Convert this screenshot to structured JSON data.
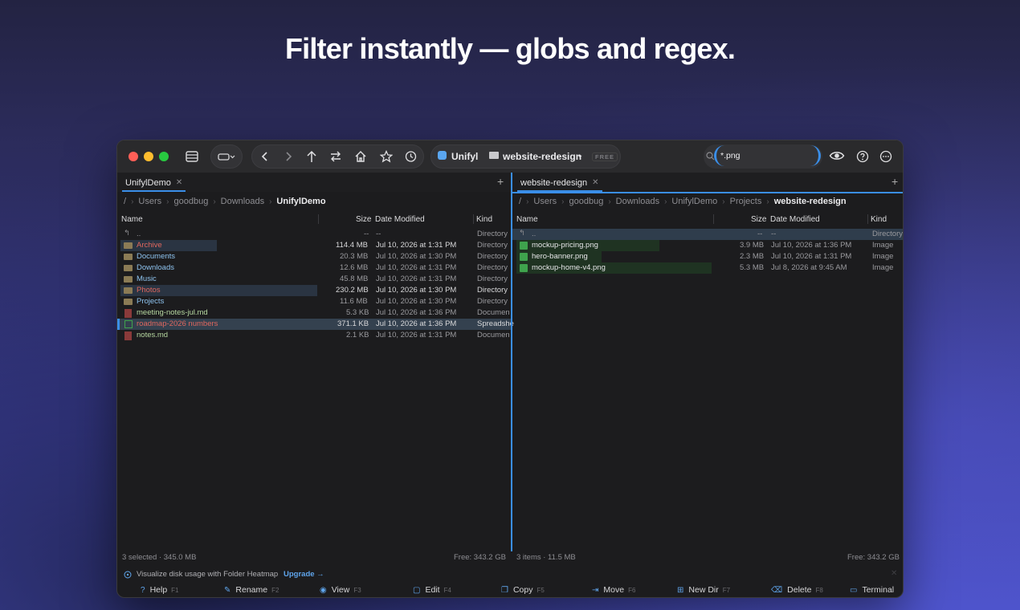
{
  "headline": "Filter instantly — globs and regex.",
  "colors": {
    "accent": "#3a8ee8",
    "folder": "#8b7b55",
    "image_icon": "#3fa34d",
    "highlight_red": "#e0675e",
    "highlight_green": "#9bd07a"
  },
  "toolbar": {
    "source_label": "Unifyl",
    "folder_label": "website-redesign",
    "badge": "FREE",
    "search_value": "*.png",
    "icons": [
      "sidebar-icon",
      "drive-icon",
      "back-icon",
      "forward-icon",
      "up-icon",
      "swap-icon",
      "home-icon",
      "star-icon",
      "history-icon",
      "search-icon",
      "eye-icon",
      "help-icon",
      "more-icon"
    ]
  },
  "left": {
    "tab_label": "UnifylDemo",
    "breadcrumb": [
      "/",
      "Users",
      "goodbug",
      "Downloads",
      "UnifylDemo"
    ],
    "columns": {
      "name": "Name",
      "size": "Size",
      "date": "Date Modified",
      "kind": "Kind"
    },
    "parent": {
      "name": "..",
      "size": "--",
      "date": "--",
      "kind": "Directory"
    },
    "rows": [
      {
        "name": "Archive",
        "size": "114.4 MB",
        "date": "Jul 10, 2026 at 1:31 PM",
        "kind": "Directory"
      },
      {
        "name": "Documents",
        "size": "20.3 MB",
        "date": "Jul 10, 2026 at 1:30 PM",
        "kind": "Directory"
      },
      {
        "name": "Downloads",
        "size": "12.6 MB",
        "date": "Jul 10, 2026 at 1:31 PM",
        "kind": "Directory"
      },
      {
        "name": "Music",
        "size": "45.8 MB",
        "date": "Jul 10, 2026 at 1:31 PM",
        "kind": "Directory"
      },
      {
        "name": "Photos",
        "size": "230.2 MB",
        "date": "Jul 10, 2026 at 1:30 PM",
        "kind": "Directory"
      },
      {
        "name": "Projects",
        "size": "11.6 MB",
        "date": "Jul 10, 2026 at 1:30 PM",
        "kind": "Directory"
      },
      {
        "name": "meeting-notes-jul.md",
        "size": "5.3 KB",
        "date": "Jul 10, 2026 at 1:36 PM",
        "kind": "Documen"
      },
      {
        "name": "roadmap-2026 numbers",
        "size": "371.1 KB",
        "date": "Jul 10, 2026 at 1:36 PM",
        "kind": "Spreadshe"
      },
      {
        "name": "notes.md",
        "size": "2.1 KB",
        "date": "Jul 10, 2026 at 1:31 PM",
        "kind": "Documen"
      }
    ],
    "status_left": "3 selected · 345.0 MB",
    "status_right": "Free: 343.2 GB"
  },
  "right": {
    "tab_label": "website-redesign",
    "breadcrumb": [
      "/",
      "Users",
      "goodbug",
      "Downloads",
      "UnifylDemo",
      "Projects",
      "website-redesign"
    ],
    "columns": {
      "name": "Name",
      "size": "Size",
      "date": "Date Modified",
      "kind": "Kind"
    },
    "parent": {
      "name": "..",
      "size": "--",
      "date": "--",
      "kind": "Directory"
    },
    "rows": [
      {
        "name": "mockup-pricing.png",
        "size": "3.9 MB",
        "date": "Jul 10, 2026 at 1:36 PM",
        "kind": "Image"
      },
      {
        "name": "hero-banner.png",
        "size": "2.3 MB",
        "date": "Jul 10, 2026 at 1:31 PM",
        "kind": "Image"
      },
      {
        "name": "mockup-home-v4.png",
        "size": "5.3 MB",
        "date": "Jul 8, 2026 at 9:45 AM",
        "kind": "Image"
      }
    ],
    "status_left": "3 items · 11.5 MB",
    "status_right": "Free: 343.2 GB"
  },
  "promo": {
    "text": "Visualize disk usage with Folder Heatmap",
    "link": "Upgrade →"
  },
  "fkeys": [
    {
      "label": "Help",
      "key": "F1"
    },
    {
      "label": "Rename",
      "key": "F2"
    },
    {
      "label": "View",
      "key": "F3"
    },
    {
      "label": "Edit",
      "key": "F4"
    },
    {
      "label": "Copy",
      "key": "F5"
    },
    {
      "label": "Move",
      "key": "F6"
    },
    {
      "label": "New Dir",
      "key": "F7"
    },
    {
      "label": "Delete",
      "key": "F8"
    },
    {
      "label": "Terminal",
      "key": ""
    }
  ]
}
